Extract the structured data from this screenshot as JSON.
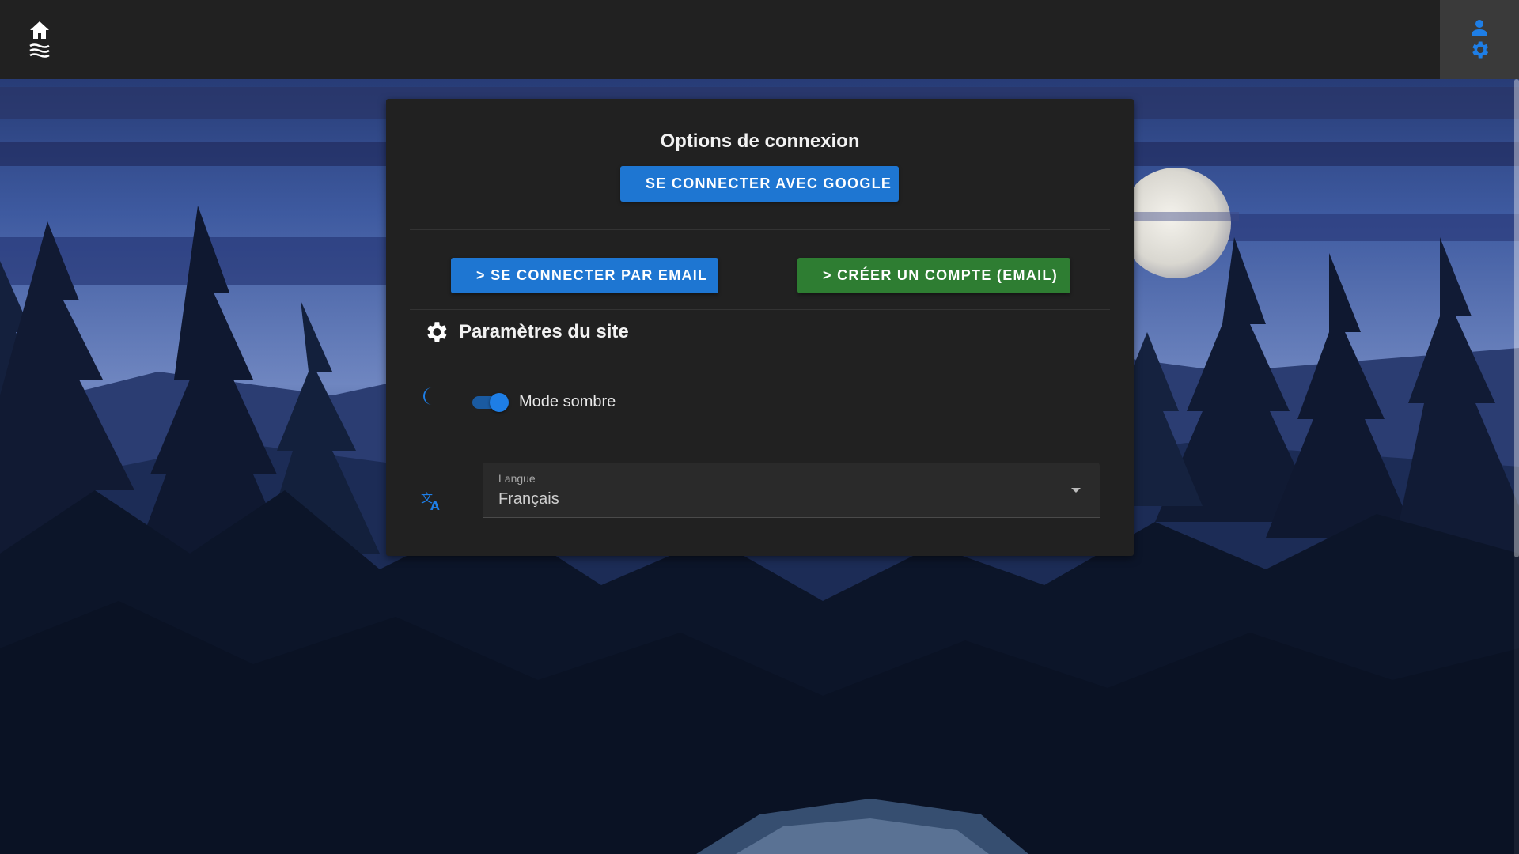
{
  "topbar": {
    "home_icon": "home-icon",
    "waves_icon": "waves-icon",
    "user_icon": "person-icon",
    "settings_icon": "gear-icon"
  },
  "login": {
    "title": "Options de connexion",
    "google_button": "SE CONNECTER AVEC GOOGLE",
    "email_login_button": "> SE CONNECTER PAR EMAIL",
    "create_account_button": "> CRÉER UN COMPTE (EMAIL)"
  },
  "settings": {
    "title": "Paramètres du site",
    "dark_mode": {
      "label": "Mode sombre",
      "enabled": true
    },
    "language": {
      "label": "Langue",
      "value": "Français"
    }
  },
  "colors": {
    "topbar": "#212121",
    "panel": "#212121",
    "primary": "#1e76d2",
    "success": "#2e7d32",
    "accent_icon": "#1e7ee6"
  }
}
